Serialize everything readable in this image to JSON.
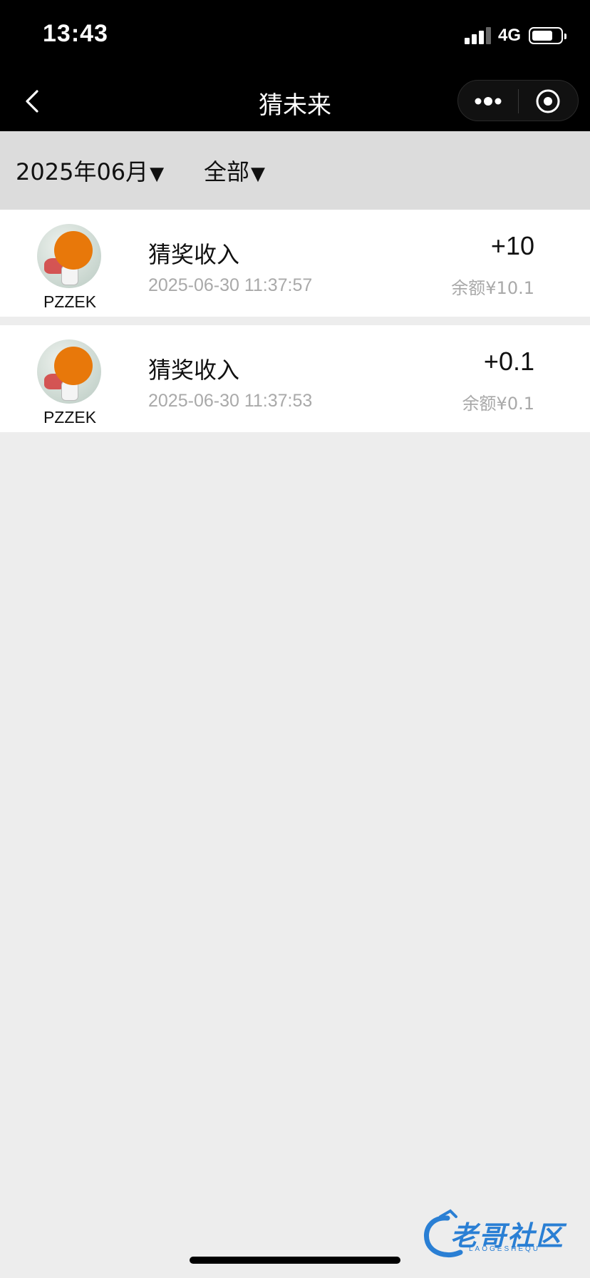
{
  "status_bar": {
    "time": "13:43",
    "network": "4G",
    "signal_bars": 3,
    "battery_level": 0.7
  },
  "nav": {
    "title": "猜未来",
    "back_icon": "chevron-left-icon",
    "more_icon": "more-dots-icon",
    "close_icon": "target-close-icon"
  },
  "filters": {
    "month": "2025年06月",
    "type": "全部",
    "arrow": "▼"
  },
  "records": [
    {
      "user": "PZZEK",
      "title": "猜奖收入",
      "time": "2025-06-30 11:37:57",
      "amount": "+10",
      "balance": "余额¥10.1"
    },
    {
      "user": "PZZEK",
      "title": "猜奖收入",
      "time": "2025-06-30 11:37:53",
      "amount": "+0.1",
      "balance": "余额¥0.1"
    }
  ],
  "watermark": {
    "text": "老哥社区",
    "sub": "LAOGESHEQU"
  },
  "colors": {
    "bar_bg": "#000000",
    "filter_bg": "#dcdcdc",
    "page_bg": "#ededed",
    "muted_text": "#a9a9a9"
  }
}
